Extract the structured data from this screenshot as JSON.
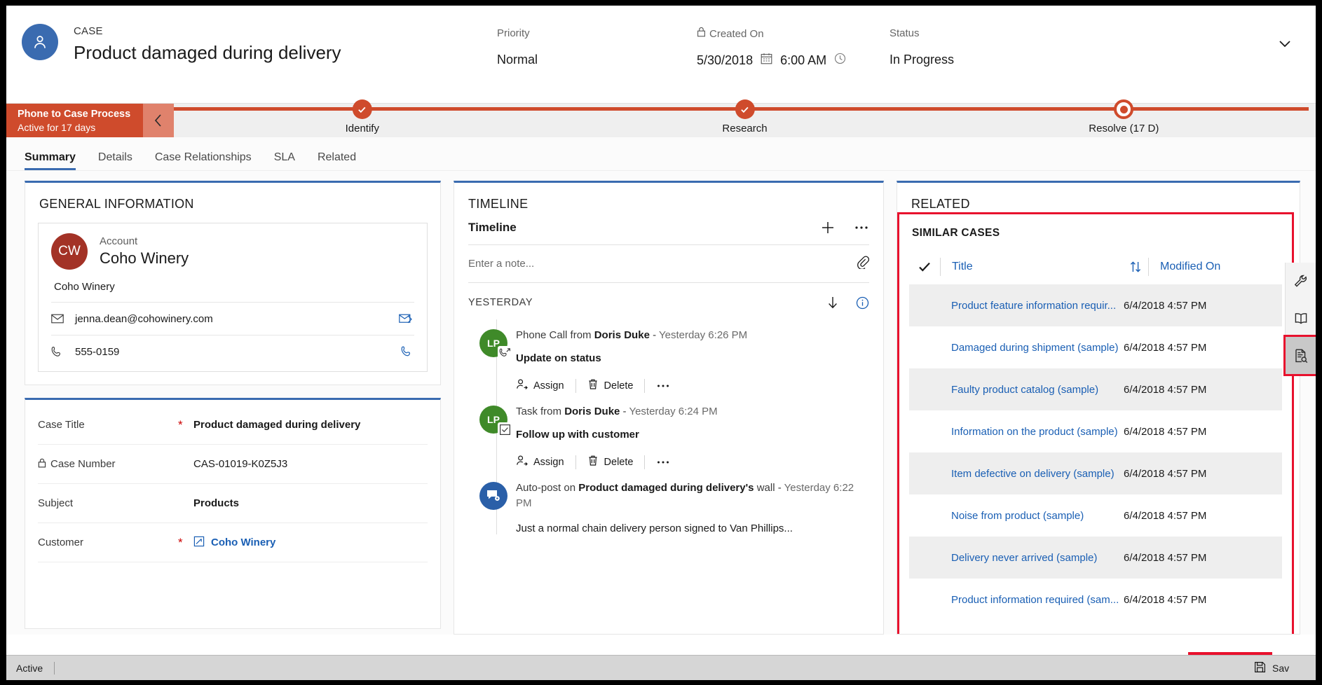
{
  "header": {
    "entity_kicker": "CASE",
    "record_title": "Product damaged during delivery",
    "avatar_icon": "contact-person-icon",
    "fields": [
      {
        "label": "Priority",
        "value": "Normal"
      },
      {
        "label": "Created On",
        "value": "5/30/2018",
        "value2": "6:00 AM",
        "locked": true
      },
      {
        "label": "Status",
        "value": "In Progress"
      }
    ],
    "collapse_icon": "chevron-down-icon"
  },
  "process_flow": {
    "name": "Phone to Case Process",
    "active_for": "Active for 17 days",
    "collapse_icon": "chevron-left-icon",
    "stages": [
      {
        "label": "Identify",
        "state": "complete"
      },
      {
        "label": "Research",
        "state": "complete"
      },
      {
        "label": "Resolve  (17 D)",
        "state": "current"
      }
    ]
  },
  "tabs": [
    {
      "label": "Summary",
      "active": true
    },
    {
      "label": "Details",
      "active": false
    },
    {
      "label": "Case Relationships",
      "active": false
    },
    {
      "label": "SLA",
      "active": false
    },
    {
      "label": "Related",
      "active": false
    }
  ],
  "general_information": {
    "card_title": "GENERAL INFORMATION",
    "account": {
      "initials": "CW",
      "label": "Account",
      "name": "Coho Winery",
      "secondary": "Coho Winery",
      "email": "jenna.dean@cohowinery.com",
      "email_icon": "envelope-icon",
      "email_action_icon": "send-email-icon",
      "phone": "555-0159",
      "phone_icon": "phone-icon",
      "phone_action_icon": "call-phone-icon"
    }
  },
  "case_fields": [
    {
      "label": "Case Title",
      "required": true,
      "locked": false,
      "value": "Product damaged during delivery",
      "link": false
    },
    {
      "label": "Case Number",
      "required": false,
      "locked": true,
      "value": "CAS-01019-K0Z5J3",
      "link": false
    },
    {
      "label": "Subject",
      "required": false,
      "locked": false,
      "value": "Products",
      "link": false
    },
    {
      "label": "Customer",
      "required": true,
      "locked": false,
      "value": "Coho Winery",
      "link": true,
      "link_icon": "account-entity-icon"
    }
  ],
  "timeline": {
    "card_title": "TIMELINE",
    "sub_title": "Timeline",
    "add_icon": "plus-icon",
    "more_icon": "ellipsis-icon",
    "note_placeholder": "Enter a note...",
    "attach_icon": "paperclip-icon",
    "day_group": "YESTERDAY",
    "sort_icon": "arrow-down-icon",
    "info_icon": "info-circle-icon",
    "actions": {
      "assign": "Assign",
      "assign_icon": "assign-person-icon",
      "delete": "Delete",
      "delete_icon": "trash-icon",
      "more_icon": "ellipsis-icon"
    },
    "items": [
      {
        "avatar": "LP",
        "avatar_color": "green",
        "badge_icon": "outgoing-call-icon",
        "kind": "Phone Call from ",
        "actor": "Doris Duke",
        "separator": " - ",
        "time": "Yesterday 6:26 PM",
        "body": "Update on status",
        "has_actions": true
      },
      {
        "avatar": "LP",
        "avatar_color": "green",
        "badge_icon": "task-checkbox-icon",
        "kind": "Task from ",
        "actor": "Doris Duke",
        "separator": "  - ",
        "time": "Yesterday 6:24 PM",
        "body": "Follow up with customer",
        "has_actions": true
      },
      {
        "avatar": "",
        "avatar_color": "blue",
        "badge_icon": "auto-post-icon",
        "kind": "Auto-post on ",
        "actor": "Product damaged during delivery's",
        "separator": " wall - ",
        "time": "Yesterday 6:22 PM",
        "body": "",
        "has_actions": false
      }
    ],
    "truncated_text": "Just a normal chain delivery person signed to Van Phillips..."
  },
  "related": {
    "card_title": "RELATED",
    "sub_title": "SIMILAR CASES",
    "columns": {
      "select_icon": "checkmark-icon",
      "title": "Title",
      "sort_icon": "sort-updown-icon",
      "modified_on": "Modified On"
    },
    "rows": [
      {
        "title": "Product feature information requir...",
        "modified_on": "6/4/2018 4:57 PM"
      },
      {
        "title": "Damaged during shipment (sample)",
        "modified_on": "6/4/2018 4:57 PM"
      },
      {
        "title": "Faulty product catalog (sample)",
        "modified_on": "6/4/2018 4:57 PM"
      },
      {
        "title": "Information on the product (sample)",
        "modified_on": "6/4/2018 4:57 PM"
      },
      {
        "title": "Item defective on delivery (sample)",
        "modified_on": "6/4/2018 4:57 PM"
      },
      {
        "title": "Noise from product (sample)",
        "modified_on": "6/4/2018 4:57 PM"
      },
      {
        "title": "Delivery never arrived (sample)",
        "modified_on": "6/4/2018 4:57 PM"
      },
      {
        "title": "Product information required (sam...",
        "modified_on": "6/4/2018 4:57 PM"
      }
    ]
  },
  "right_rail": [
    {
      "icon": "wrench-icon",
      "selected": false
    },
    {
      "icon": "book-icon",
      "selected": false
    },
    {
      "icon": "document-search-icon",
      "selected": true
    }
  ],
  "status_bar": {
    "state": "Active",
    "save_label": "Sav",
    "save_icon": "save-disk-icon"
  },
  "colors": {
    "accent_blue": "#3a6bb0",
    "link_blue": "#1a5fb4",
    "process_red": "#cf4b2c",
    "highlight_red": "#e8112d",
    "account_red": "#a33226",
    "timeline_green": "#3f8a29"
  }
}
